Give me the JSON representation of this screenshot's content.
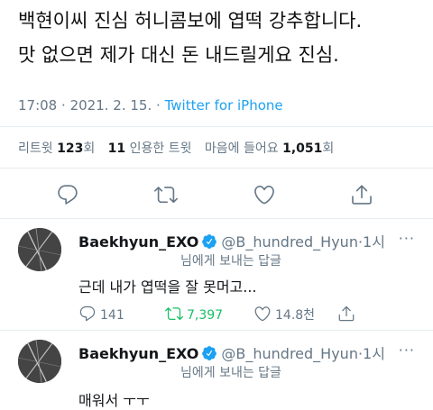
{
  "tweet": {
    "line1": "백현이씨 진심 허니콤보에 엽떡 강추합니다.",
    "line2": "맛 없으면 제가 대신 돈 내드릴게요 진심.",
    "time": "17:08",
    "date": "2021. 2. 15.",
    "sep": "·",
    "source": "Twitter for iPhone"
  },
  "stats": {
    "retweets_label": "리트윗",
    "retweets_count": "123",
    "retweets_unit": "회",
    "quotes_count": "11",
    "quotes_label": "인용한 트윗",
    "likes_label": "마음에 들어요",
    "likes_count": "1,051",
    "likes_unit": "회"
  },
  "replies": [
    {
      "name": "Baekhyun_EXO",
      "handle": "@B_hundred_Hyun",
      "sep": "·",
      "time": "1시",
      "more": "···",
      "reply_to": "님에게 보내는 답글",
      "text": "근데 내가 엽떡을 잘 못머고...",
      "reply_count": "141",
      "retweet_count": "7,397",
      "like_count": "14.8천"
    },
    {
      "name": "Baekhyun_EXO",
      "handle": "@B_hundred_Hyun",
      "sep": "·",
      "time": "1시",
      "more": "···",
      "reply_to": "님에게 보내는 답글",
      "text": "매워서 ㅜㅜ"
    }
  ],
  "colors": {
    "accent": "#1da1f2",
    "retweet": "#17bf63",
    "muted": "#657786"
  },
  "icons": [
    "reply-icon",
    "retweet-icon",
    "like-icon",
    "share-icon",
    "verified-icon",
    "more-icon"
  ]
}
